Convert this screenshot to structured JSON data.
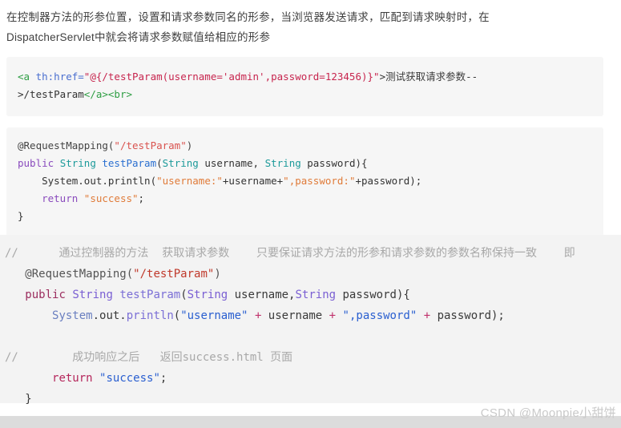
{
  "intro": {
    "line1": "在控制器方法的形参位置，设置和请求参数同名的形参，当浏览器发送请求，匹配到请求映射时，在",
    "line2": "DispatcherServlet中就会将请求参数赋值给相应的形参"
  },
  "html_block": {
    "tag_open": "<a",
    "attr": " th:href=",
    "str_start": "\"@{/testParam(username='admin',password=123456)}\"",
    "gt": ">",
    "cjk_text": "测试获取请求参数--",
    "line2_plain": ">/testParam",
    "line2_tag_close": "</a><br>"
  },
  "java_block": {
    "annotation": "@RequestMapping(",
    "annotation_str": "\"/testParam\"",
    "annotation_end": ")",
    "kw_public": "public",
    "type_string": "String",
    "fn_name": "testParam",
    "paren_open": "(",
    "param_type1": "String",
    "param_name1": " username, ",
    "param_type2": "String",
    "param_name2": " password",
    "paren_close": "){",
    "sysout": "System.out.println(",
    "str1": "\"username:\"",
    "plus1": "+username+",
    "str2": "\",password:\"",
    "plus2": "+password",
    "sysout_end": ");",
    "kw_return": "return",
    "return_str": "\"success\"",
    "semicolon": ";",
    "brace_close": "}"
  },
  "band_block": {
    "comment1_slash": "//",
    "comment1_text": "通过控制器的方法  获取请求参数    只要保证请求方法的形参和请求参数的参数名称保持一致    即",
    "annotation": "@RequestMapping(",
    "annotation_str": "\"/testParam\"",
    "annotation_end": ")",
    "kw_public": "public",
    "type_string": "String",
    "fn_name": "testParam",
    "paren_open": "(",
    "param_type1": "String",
    "param_name1": " username,",
    "param_type2": "String",
    "param_name2": " password",
    "paren_close": "){",
    "sysout_sys": "System",
    "sysout_out": ".out.",
    "sysout_fn": "println",
    "sysout_paren": "(",
    "str1": "\"username\"",
    "plus1": "+",
    "var1": " username ",
    "plus2": "+",
    "str2": "\",password\"",
    "plus3": "+",
    "var2": " password",
    "sysout_end": ");",
    "comment2_slash": "//",
    "comment2_text": "成功响应之后   返回success.html 页面",
    "kw_return": "return",
    "return_str": "\"success\"",
    "semicolon": ";",
    "brace_close": "}"
  },
  "watermark": {
    "text": "CSDN @Moonpie小甜饼"
  }
}
